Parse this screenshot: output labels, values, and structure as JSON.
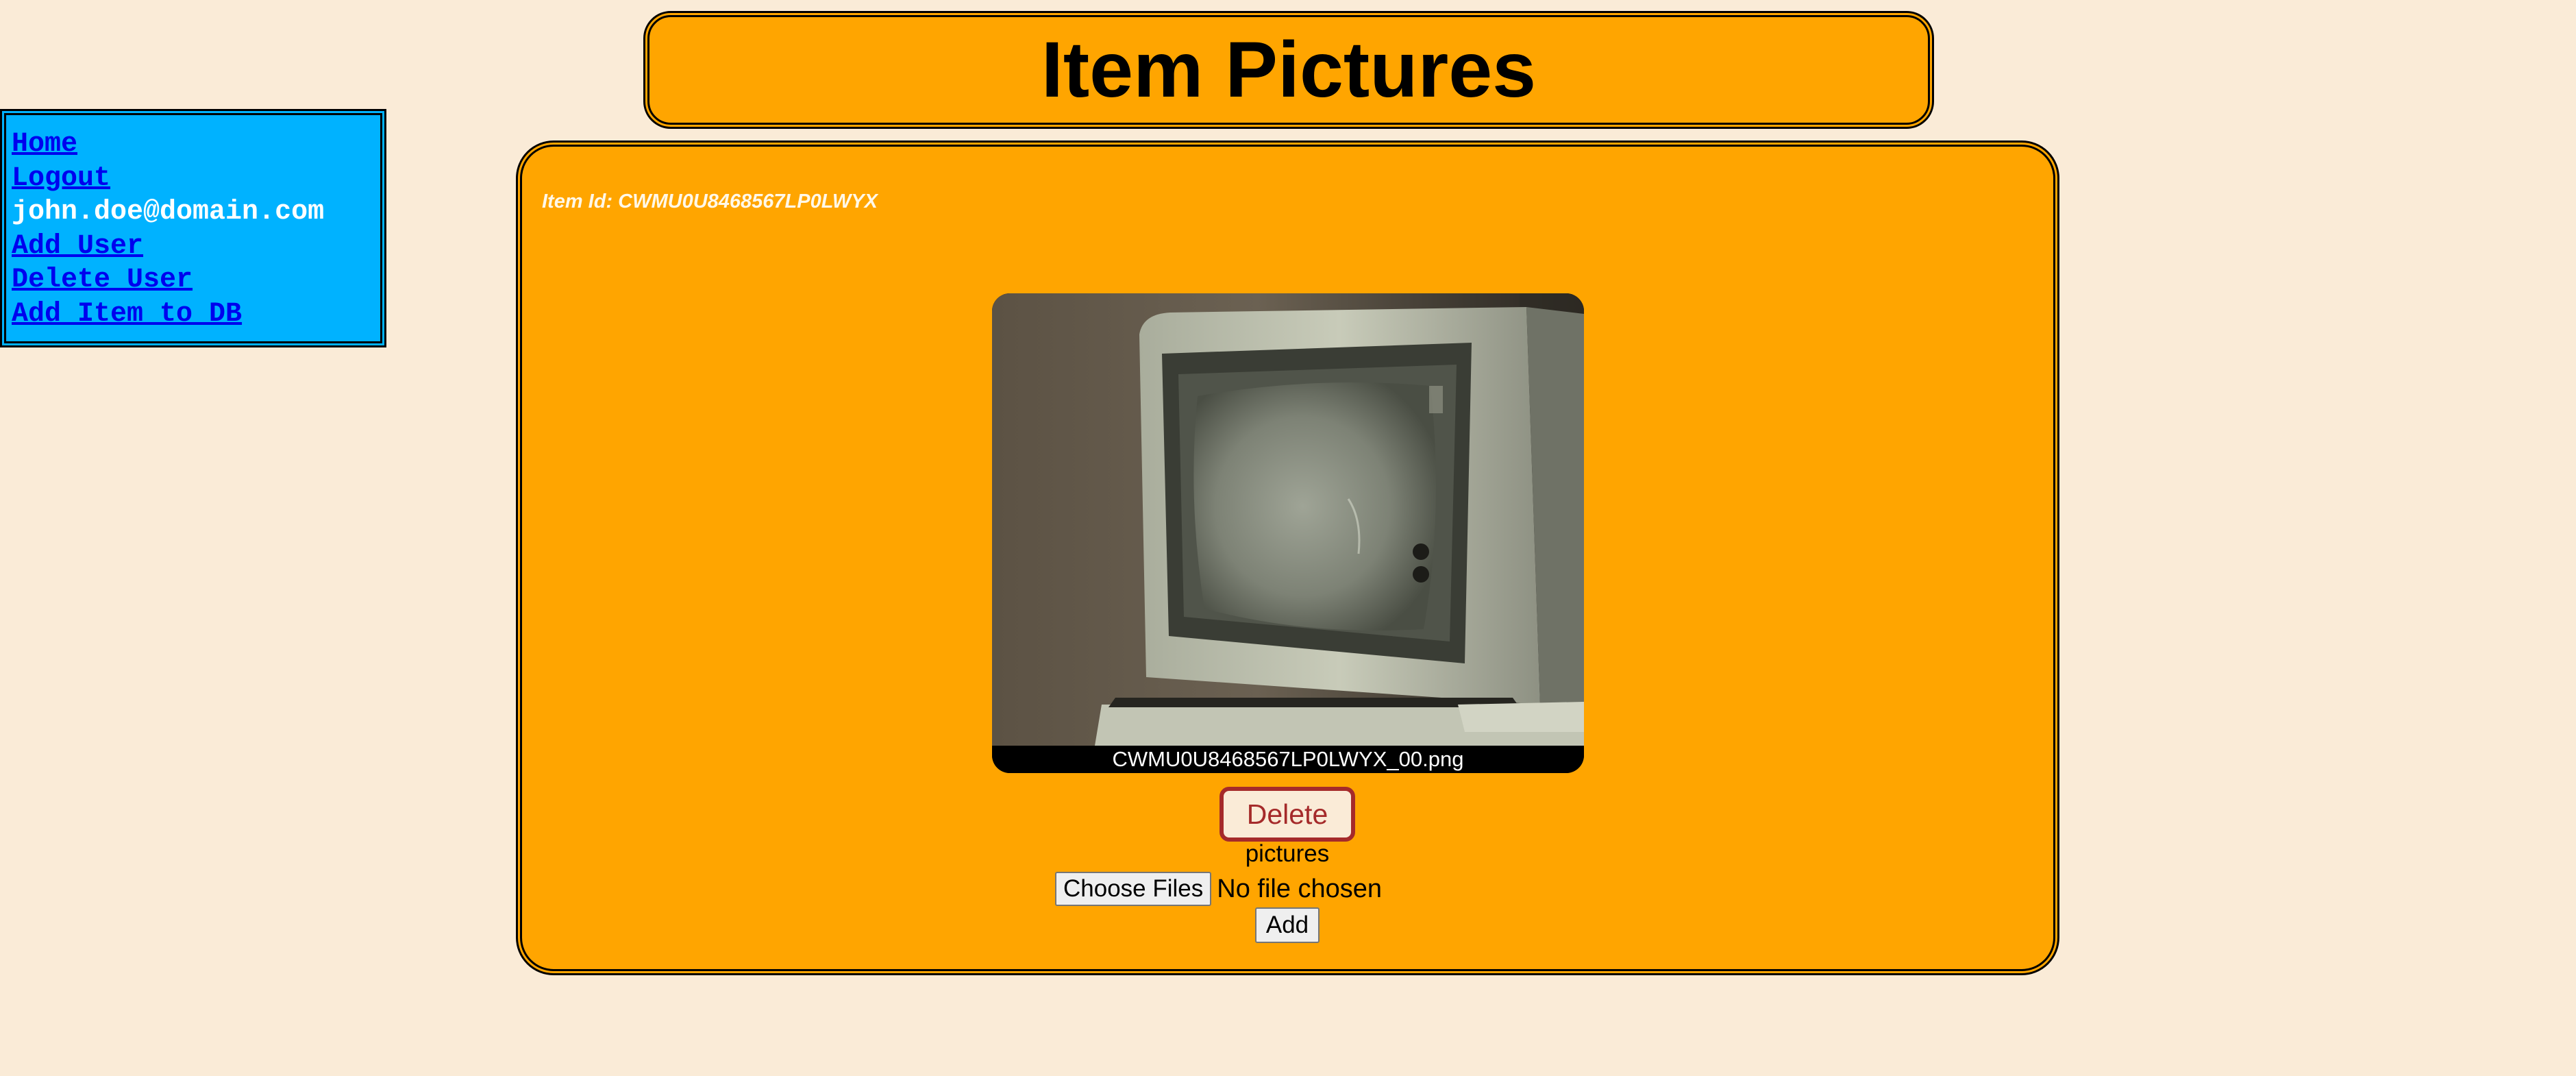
{
  "header": {
    "title": "Item Pictures"
  },
  "sidebar": {
    "items": [
      {
        "label": "Home",
        "type": "link"
      },
      {
        "label": "Logout",
        "type": "link"
      },
      {
        "label": "john.doe@domain.com",
        "type": "text"
      },
      {
        "label": "Add User",
        "type": "link"
      },
      {
        "label": "Delete User",
        "type": "link"
      },
      {
        "label": "Add Item to DB",
        "type": "link"
      }
    ]
  },
  "main": {
    "item_id": "Item Id: CWMU0U8468567LP0LWYX",
    "pictures": [
      {
        "filename": "CWMU0U8468567LP0LWYX_00.png",
        "icon": "vintage-computer-monitor-photo"
      }
    ],
    "delete_label": "Delete",
    "pictures_label": "pictures",
    "file_input": {
      "button_label": "Choose Files",
      "status": "No file chosen"
    },
    "add_label": "Add"
  },
  "colors": {
    "page_background": "#faebd7",
    "panel_orange": "#ffa500",
    "sidebar_blue": "#00b2ff",
    "link_blue": "#0000ee",
    "delete_brown": "#a52a2a"
  }
}
